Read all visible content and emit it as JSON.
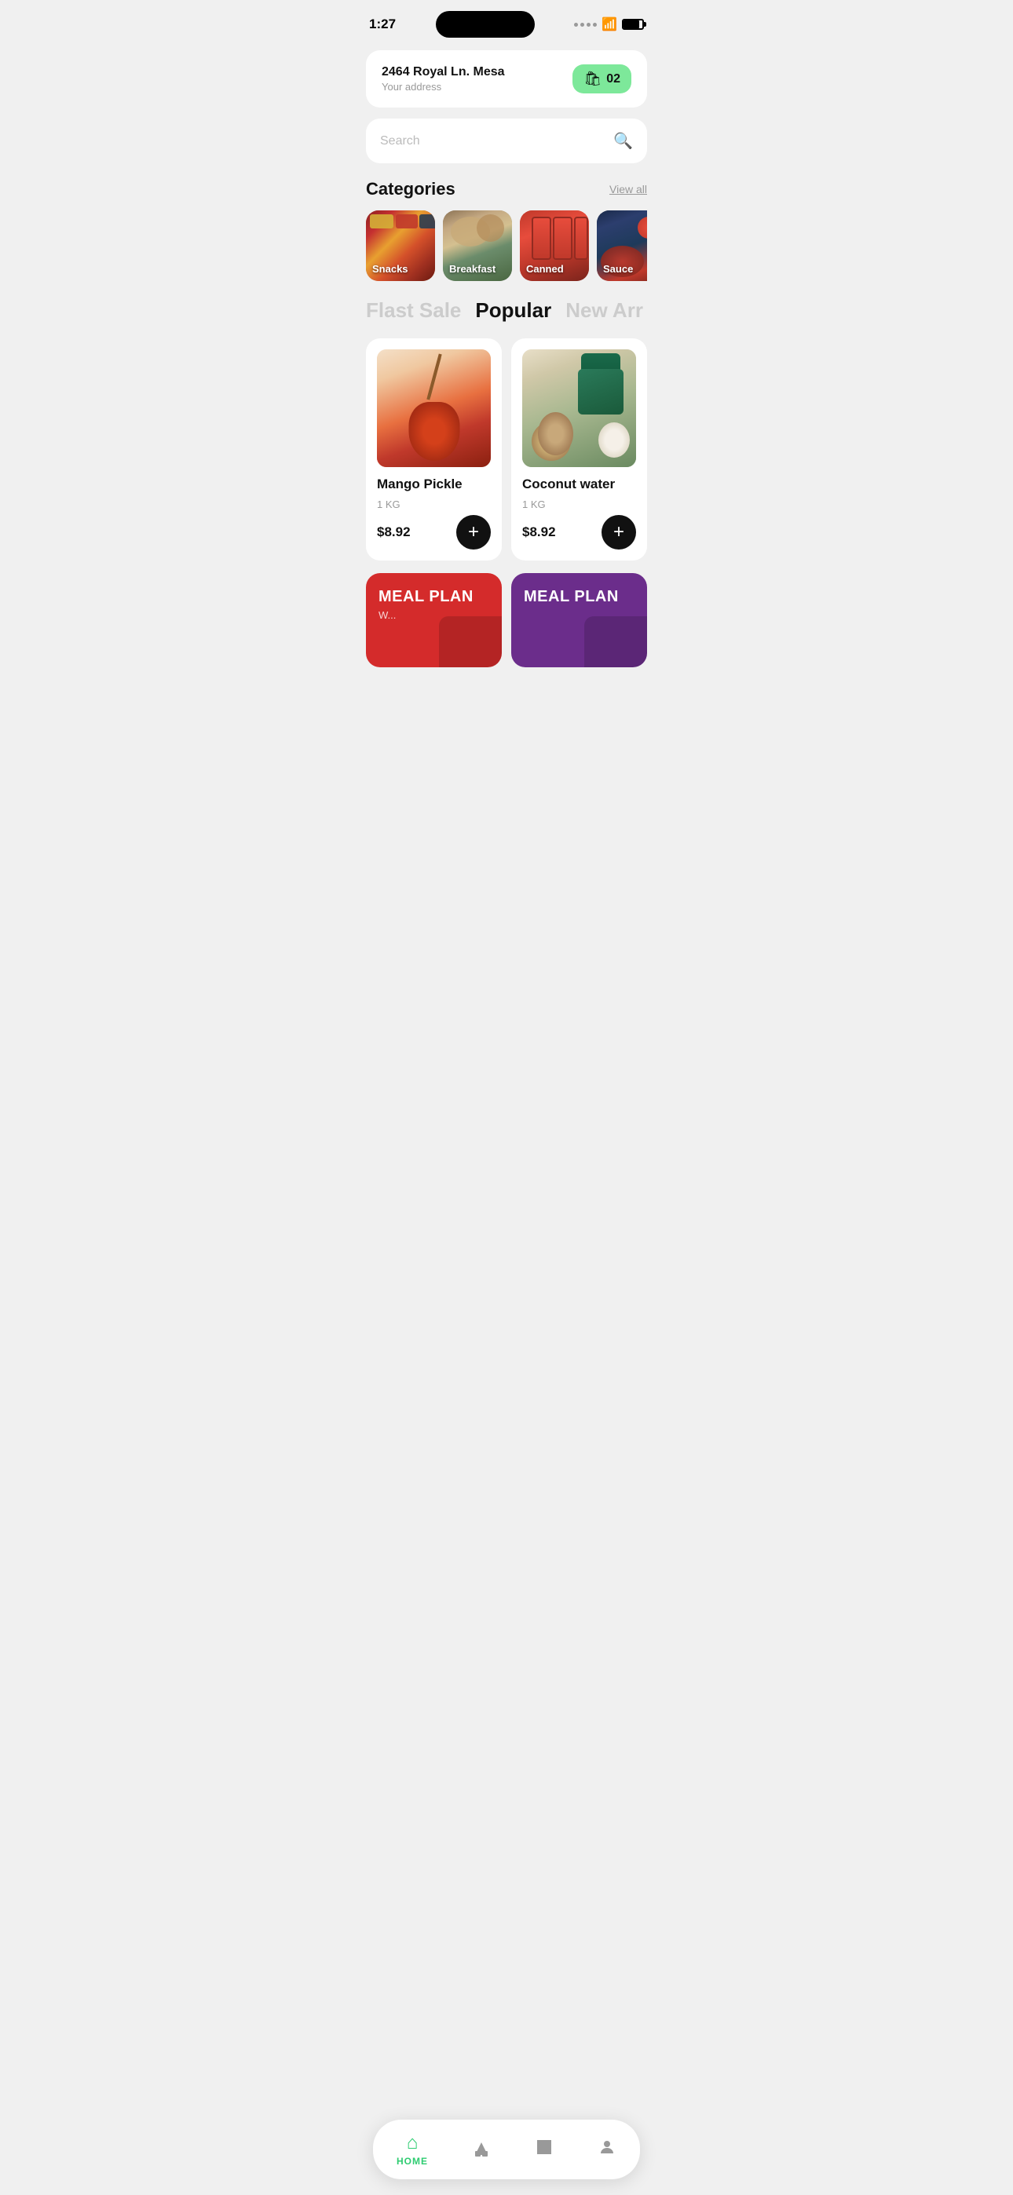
{
  "statusBar": {
    "time": "1:27"
  },
  "header": {
    "address": "2464 Royal Ln. Mesa",
    "addressSub": "Your address",
    "cartCount": "02"
  },
  "search": {
    "placeholder": "Search"
  },
  "categories": {
    "title": "Categories",
    "viewAll": "View all",
    "items": [
      {
        "id": "snacks",
        "label": "Snacks"
      },
      {
        "id": "breakfast",
        "label": "Breakfast"
      },
      {
        "id": "canned",
        "label": "Canned"
      },
      {
        "id": "sauce",
        "label": "Sauce"
      }
    ]
  },
  "filterTabs": {
    "tabs": [
      {
        "id": "flash-sale",
        "label": "Flast Sale",
        "active": false
      },
      {
        "id": "popular",
        "label": "Popular",
        "active": true
      },
      {
        "id": "new-arrivals",
        "label": "New Arr",
        "active": false
      }
    ]
  },
  "products": {
    "items": [
      {
        "id": "mango-pickle",
        "name": "Mango Pickle",
        "weight": "1 KG",
        "price": "$8.92"
      },
      {
        "id": "coconut-water",
        "name": "Coconut water",
        "weight": "1 KG",
        "price": "$8.92"
      }
    ]
  },
  "mealPlans": {
    "items": [
      {
        "id": "meal-plan-red",
        "title": "MEAL PLAN",
        "color": "red",
        "sub": "W..."
      },
      {
        "id": "meal-plan-purple",
        "title": "MEAL PLAN",
        "color": "purple",
        "sub": ""
      }
    ]
  },
  "bottomNav": {
    "items": [
      {
        "id": "home",
        "label": "HOME",
        "icon": "🏠",
        "active": true
      },
      {
        "id": "categories",
        "label": "",
        "icon": "▲◆",
        "active": false
      },
      {
        "id": "orders",
        "label": "",
        "icon": "📁",
        "active": false
      },
      {
        "id": "profile",
        "label": "",
        "icon": "👤",
        "active": false
      }
    ]
  },
  "colors": {
    "accent": "#2ecc71",
    "dark": "#111111",
    "gray": "#999999"
  }
}
